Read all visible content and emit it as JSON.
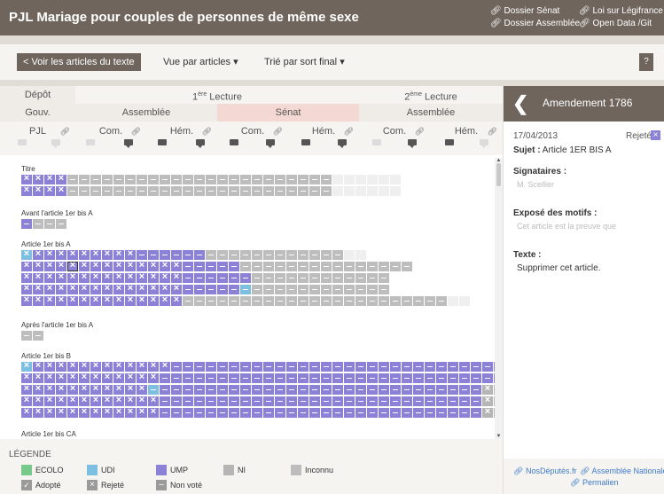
{
  "app": {
    "title": "PJL Mariage pour couples de personnes de même sexe"
  },
  "top_links": {
    "col1": [
      "Dossier Sénat",
      "Dossier Assemblée"
    ],
    "col2": [
      "Loi sur Légifrance",
      "Open Data /Git"
    ],
    "link_icon": "link-icon"
  },
  "toolbar": {
    "back_label": "< Voir les articles du texte",
    "view_label": "Vue par articles",
    "sort_label": "Trié par sort final",
    "help_label": "?"
  },
  "table_header": {
    "row1": [
      "Dépôt",
      "1ère Lecture",
      "2ème Lecture"
    ],
    "row1_sup": {
      "lecture1": "ère",
      "lecture2": "ème"
    },
    "row1_text": {
      "lecture1": "Lecture",
      "lecture2": "Lecture"
    },
    "row2": [
      "Gouv.",
      "Assemblée",
      "Sénat",
      "Assemblée"
    ],
    "row3": [
      "PJL",
      "Com.",
      "Hém.",
      "Com.",
      "Hém.",
      "Com.",
      "Hém."
    ],
    "colors": {
      "senat": "#f4d8d3",
      "header": "#efebe6"
    }
  },
  "sections": [
    {
      "title": "Titre"
    },
    {
      "title": "Avant l'article 1er bis A"
    },
    {
      "title": "Article 1er bis A"
    },
    {
      "title": "Après l'article 1er bis A"
    },
    {
      "title": "Article 1er bis B"
    },
    {
      "title": "Article 1er bis CA"
    }
  ],
  "legend": {
    "title": "LÉGENDE",
    "groups": [
      {
        "label": "ECOLO",
        "color": "#77c98a"
      },
      {
        "label": "UDI",
        "color": "#7cbfe0"
      },
      {
        "label": "UMP",
        "color": "#8b82d8"
      },
      {
        "label": "NI",
        "color": "#b5b5b5"
      },
      {
        "label": "Inconnu",
        "color": "#bdbdbd"
      }
    ],
    "states": [
      {
        "label": "Adopté",
        "icon": "check-icon"
      },
      {
        "label": "Rejeté",
        "icon": "cross-icon"
      },
      {
        "label": "Non voté",
        "icon": "dash-icon"
      }
    ]
  },
  "amendment": {
    "title": "Amendement 1786",
    "date": "17/04/2013",
    "status": "Rejeté",
    "subject_label": "Sujet :",
    "subject": "Article 1ER BIS A",
    "signataires_label": "Signataires :",
    "signataires": "M. Scellier",
    "expose_label": "Exposé des motifs :",
    "expose": "Cet article est la preuve que",
    "texte_label": "Texte :",
    "texte": "Supprimer cet article."
  },
  "footer_links": [
    "NosDéputés.fr",
    "Assemblée Nationale",
    "Permalien"
  ]
}
